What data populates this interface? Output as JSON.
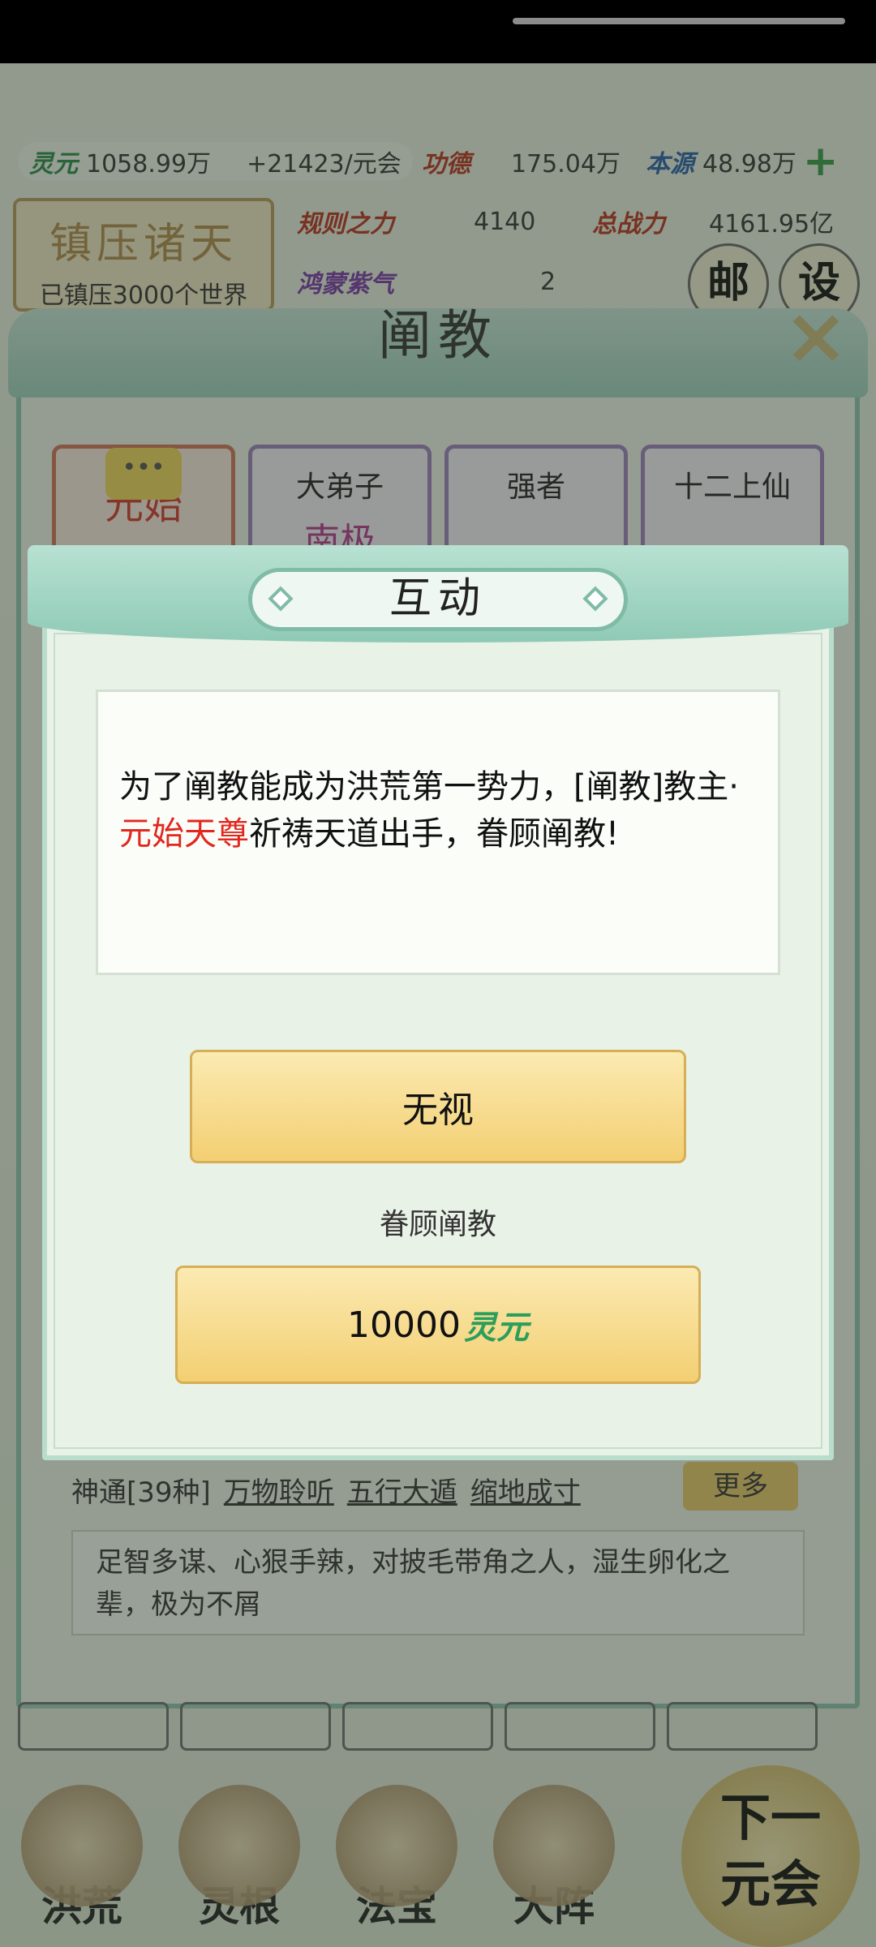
{
  "status_bar": {},
  "resources": {
    "lingyuan_label": "灵元",
    "lingyuan_value": "1058.99万",
    "lingyuan_rate": "+21423/元会",
    "gongde_label": "功德",
    "gongde_value": "175.04万",
    "benyuan_label": "本源",
    "benyuan_value": "48.98万",
    "add_icon": "plus-icon",
    "guize_label": "规则之力",
    "guize_value": "4140",
    "zhanli_label": "总战力",
    "zhanli_value": "4161.95亿",
    "hongmeng_label": "鸿蒙紫气",
    "hongmeng_value": "2"
  },
  "seal": {
    "title": "镇压诸天",
    "subtitle": "已镇压3000个世界"
  },
  "top_buttons": {
    "mail": "邮",
    "settings": "设"
  },
  "panel": {
    "title": "阐教",
    "close_icon": "close-icon",
    "cards": [
      {
        "role": "",
        "name": "元始"
      },
      {
        "role": "大弟子",
        "name": "南极"
      },
      {
        "role": "强者",
        "name": ""
      },
      {
        "role": "十二上仙",
        "name": ""
      }
    ],
    "chat_icon": "chat-bubble-icon",
    "skills_label": "神通[39种]",
    "skills": [
      "万物聆听",
      "五行大遁",
      "缩地成寸"
    ],
    "more_label": "更多",
    "description": "足智多谋、心狠手辣，对披毛带角之人，湿生卵化之辈，极为不屑"
  },
  "bottom_nav": {
    "items": [
      "洪荒",
      "灵根",
      "法宝",
      "大阵"
    ],
    "next_label_line1": "下一",
    "next_label_line2": "元会"
  },
  "dialog": {
    "title": "互动",
    "message_part1": "为了阐教能成为洪荒第一势力，[阐教]教主·",
    "message_highlight": "元始天尊",
    "message_part2": "祈祷天道出手，眷顾阐教!",
    "ignore_label": "无视",
    "favor_label": "眷顾阐教",
    "cost_amount": "10000",
    "cost_currency": "灵元",
    "colors": {
      "highlight": "#e1281e",
      "currency": "#2c9e5a",
      "gold_button": "#f3cf72",
      "dialog_header": "#8fcab6"
    }
  }
}
